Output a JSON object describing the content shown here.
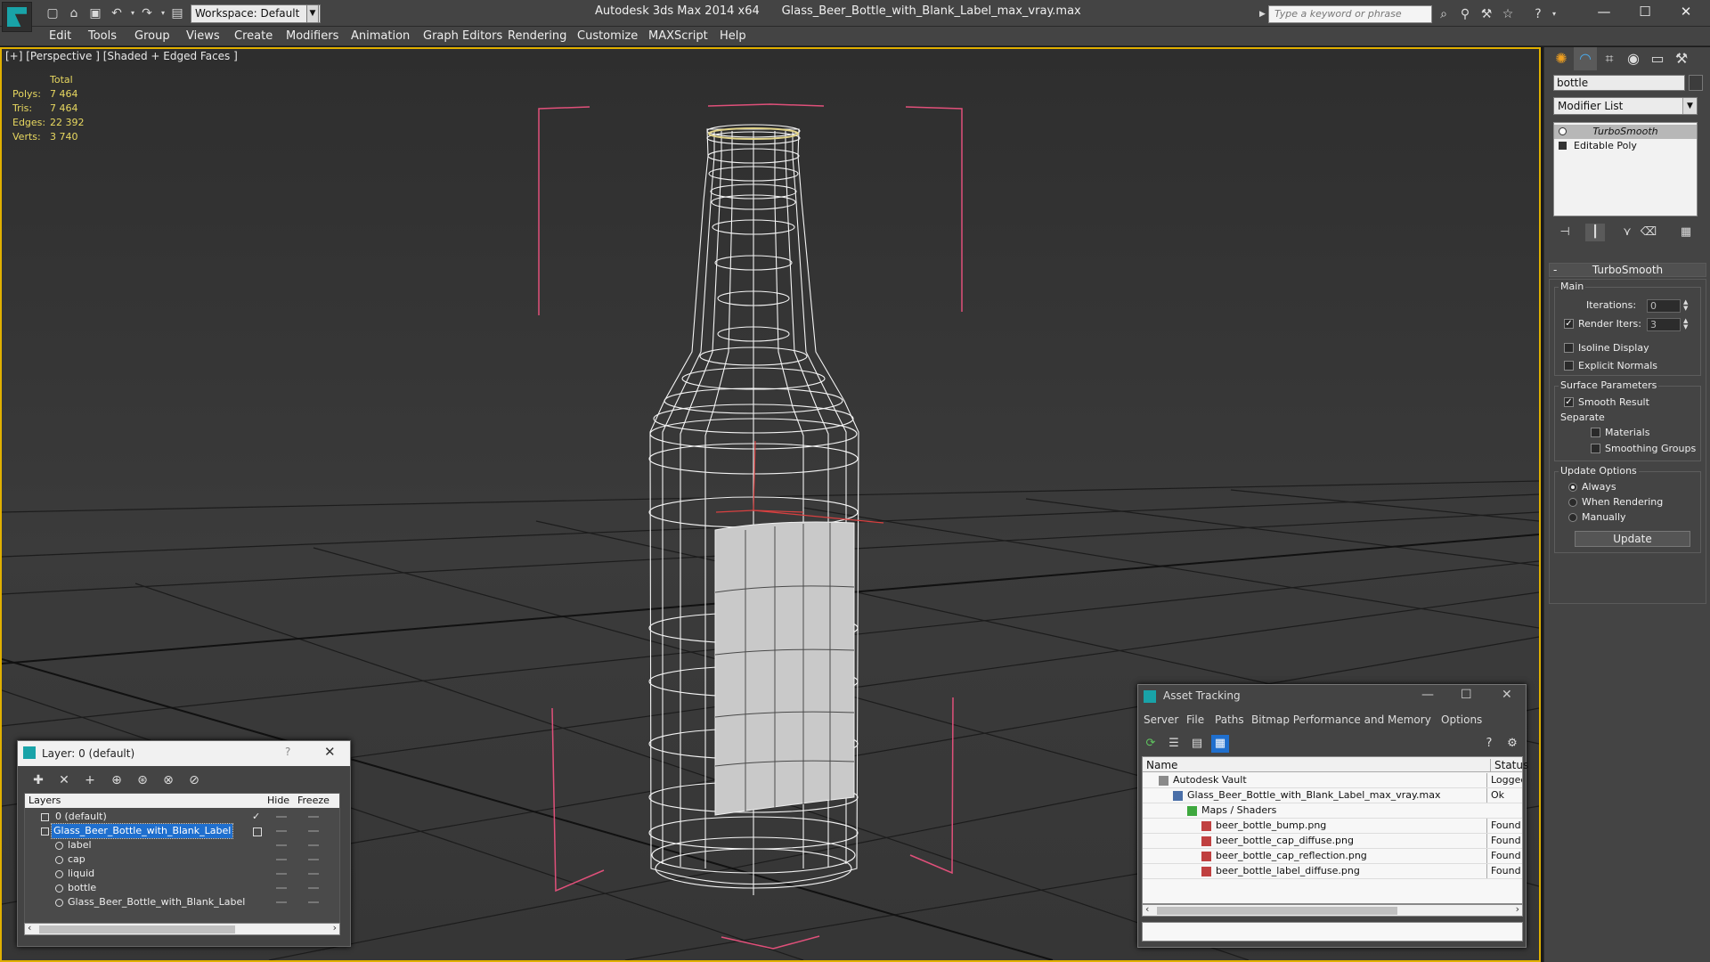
{
  "titlebar": {
    "workspace": "Workspace: Default",
    "app_name": "Autodesk 3ds Max  2014 x64",
    "file_name": "Glass_Beer_Bottle_with_Blank_Label_max_vray.max",
    "search_placeholder": "Type a keyword or phrase"
  },
  "menu": [
    "Edit",
    "Tools",
    "Group",
    "Views",
    "Create",
    "Modifiers",
    "Animation",
    "Graph Editors",
    "Rendering",
    "Customize",
    "MAXScript",
    "Help"
  ],
  "viewport": {
    "label": "[+] [Perspective ] [Shaded + Edged Faces ]",
    "stats_header": "Total",
    "stats": [
      {
        "key": "Polys:",
        "value": "7 464"
      },
      {
        "key": "Tris:",
        "value": "7 464"
      },
      {
        "key": "Edges:",
        "value": "22 392"
      },
      {
        "key": "Verts:",
        "value": "3 740"
      }
    ]
  },
  "command_panel": {
    "object_name": "bottle",
    "modifier_list": "Modifier List",
    "stack": [
      "TurboSmooth",
      "Editable Poly"
    ],
    "rollout_title": "TurboSmooth",
    "main_group": "Main",
    "iterations_label": "Iterations:",
    "iterations_value": "0",
    "render_iters_label": "Render Iters:",
    "render_iters_value": "3",
    "render_iters_checked": true,
    "isoline_label": "Isoline Display",
    "explicit_normals_label": "Explicit Normals",
    "surface_group": "Surface Parameters",
    "smooth_result_label": "Smooth Result",
    "separate_label": "Separate",
    "materials_label": "Materials",
    "smoothing_groups_label": "Smoothing Groups",
    "update_group": "Update Options",
    "update_always": "Always",
    "update_when_rendering": "When Rendering",
    "update_manually": "Manually",
    "update_button": "Update"
  },
  "layer_dialog": {
    "title": "Layer: 0 (default)",
    "help": "?",
    "columns": [
      "Layers",
      "Hide",
      "Freeze"
    ],
    "rows": [
      {
        "name": "0 (default)",
        "indent": 0,
        "type": "layer"
      },
      {
        "name": "Glass_Beer_Bottle_with_Blank_Label",
        "indent": 0,
        "type": "layer",
        "selected": true
      },
      {
        "name": "label",
        "indent": 1,
        "type": "object"
      },
      {
        "name": "cap",
        "indent": 1,
        "type": "object"
      },
      {
        "name": "liquid",
        "indent": 1,
        "type": "object"
      },
      {
        "name": "bottle",
        "indent": 1,
        "type": "object"
      },
      {
        "name": "Glass_Beer_Bottle_with_Blank_Label",
        "indent": 1,
        "type": "object"
      }
    ]
  },
  "asset_dialog": {
    "title": "Asset Tracking",
    "menu": [
      "Server",
      "File",
      "Paths",
      "Bitmap Performance and Memory",
      "Options"
    ],
    "columns": [
      "Name",
      "Status"
    ],
    "rows": [
      {
        "name": "Autodesk Vault",
        "status": "Logged",
        "indent": 0,
        "icon": "vault-icon"
      },
      {
        "name": "Glass_Beer_Bottle_with_Blank_Label_max_vray.max",
        "status": "Ok",
        "indent": 1,
        "icon": "max-file-icon"
      },
      {
        "name": "Maps / Shaders",
        "status": "",
        "indent": 2,
        "icon": "folder-icon"
      },
      {
        "name": "beer_bottle_bump.png",
        "status": "Found",
        "indent": 3,
        "icon": "png-icon"
      },
      {
        "name": "beer_bottle_cap_diffuse.png",
        "status": "Found",
        "indent": 3,
        "icon": "png-icon"
      },
      {
        "name": "beer_bottle_cap_reflection.png",
        "status": "Found",
        "indent": 3,
        "icon": "png-icon"
      },
      {
        "name": "beer_bottle_label_diffuse.png",
        "status": "Found",
        "indent": 3,
        "icon": "png-icon"
      }
    ]
  },
  "colors": {
    "viewport_border": "#e0b000",
    "stats_text": "#e8d860",
    "selection_blue": "#1f6fce",
    "bbox_pink": "#e0507a",
    "wire_white": "#ffffff"
  }
}
